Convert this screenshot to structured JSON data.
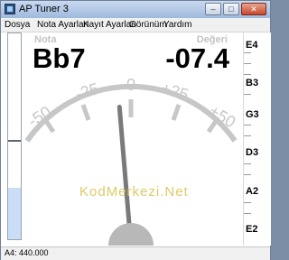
{
  "window": {
    "title": "AP Tuner 3",
    "controls": [
      "minimize",
      "maximize",
      "close"
    ]
  },
  "menu": {
    "items": [
      "Dosya",
      "Nota Ayarları",
      "Kayıt Ayarları",
      "Görünüm",
      "Yardım"
    ]
  },
  "display": {
    "note_caption": "Nota",
    "value_caption": "Değeri",
    "note": "Bb7",
    "value": "-07.4",
    "ticks": [
      "-50",
      "-25",
      "0",
      "+25",
      "+50"
    ],
    "needle_cents": -7.4,
    "watermark": "KodMerkezi.Net"
  },
  "level_meter": {
    "level_fraction": 0.25
  },
  "scale": {
    "labels": [
      "E4",
      "B3",
      "G3",
      "D3",
      "A2",
      "E2"
    ]
  },
  "status": {
    "text": "A4: 440.000"
  }
}
